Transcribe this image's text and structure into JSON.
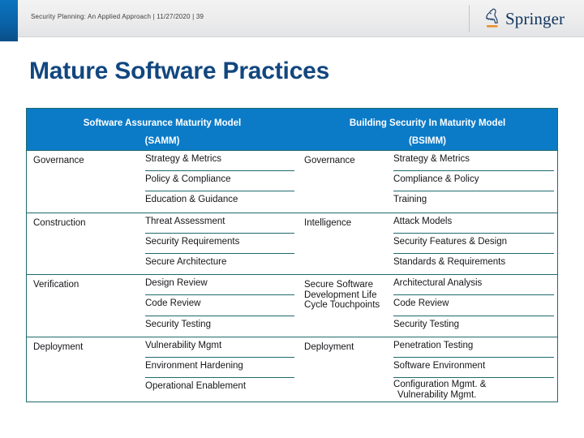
{
  "header": {
    "meta_text": "Security Planning: An Applied Approach | 11/27/2020 | 39",
    "brand": "Springer",
    "brand_icon": "springer-knight-icon",
    "accent_blue": "#0b74bf",
    "divider_color": "#c3c4c7"
  },
  "slide": {
    "title": "Mature Software Practices",
    "title_color": "#12477f"
  },
  "matrix": {
    "header_bg": "#0b7bc8",
    "border_color": "#1f6a6d",
    "columns": [
      {
        "title_line1": "Software Assurance Maturity Model",
        "title_line2": "(SAMM)"
      },
      {
        "title_line1": "Building Security In Maturity Model",
        "title_line2": "(BSIMM)"
      }
    ],
    "groups": [
      {
        "samm_domain": "Governance",
        "bsimm_domain": "Governance",
        "samm_practices": [
          "Strategy & Metrics",
          "Policy & Compliance",
          "Education & Guidance"
        ],
        "bsimm_practices": [
          "Strategy & Metrics",
          "Compliance & Policy",
          "Training"
        ]
      },
      {
        "samm_domain": "Construction",
        "bsimm_domain": "Intelligence",
        "samm_practices": [
          "Threat Assessment",
          "Security Requirements",
          "Secure Architecture"
        ],
        "bsimm_practices": [
          "Attack Models",
          "Security Features & Design",
          "Standards & Requirements"
        ]
      },
      {
        "samm_domain": "Verification",
        "bsimm_domain": "Secure Software Development Life Cycle Touchpoints",
        "samm_practices": [
          "Design Review",
          "Code Review",
          "Security Testing"
        ],
        "bsimm_practices": [
          "Architectural Analysis",
          "Code Review",
          "Security Testing"
        ]
      },
      {
        "samm_domain": "Deployment",
        "bsimm_domain": "Deployment",
        "samm_practices": [
          "Vulnerability Mgmt",
          "Environment Hardening",
          "Operational Enablement"
        ],
        "bsimm_practices": [
          "Penetration Testing",
          "Software Environment",
          "Configuration Mgmt. &"
        ],
        "bsimm_last_line2": "Vulnerability Mgmt."
      }
    ]
  }
}
